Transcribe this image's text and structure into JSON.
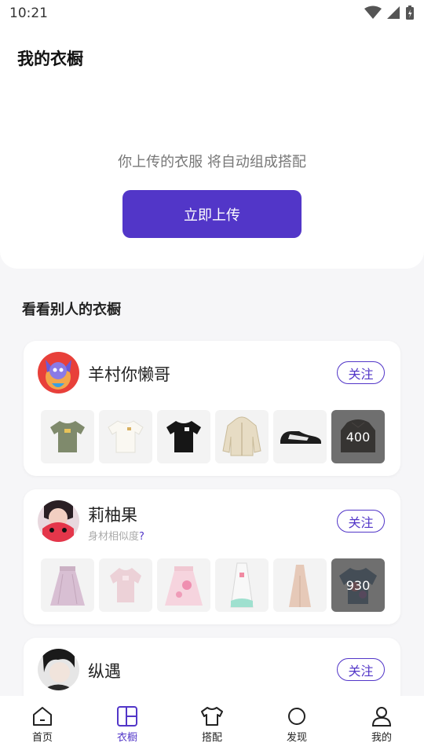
{
  "status_bar": {
    "time": "10:21"
  },
  "header": {
    "title": "我的衣橱"
  },
  "empty_state": {
    "hint": "你上传的衣服 将自动组成搭配",
    "upload_label": "立即上传"
  },
  "section": {
    "title": "看看别人的衣橱"
  },
  "users": [
    {
      "name": "羊村你懒哥",
      "follow_label": "关注",
      "clothes": [
        "olive-tshirt",
        "white-tshirt",
        "black-tshirt",
        "beige-hoodie-jacket",
        "black-white-sneaker"
      ],
      "more_count": "400"
    },
    {
      "name": "莉柚果",
      "similarity_label": "身材相似度",
      "similarity_value": "?",
      "follow_label": "关注",
      "clothes": [
        "pink-skirt",
        "pink-blouse",
        "pink-tulle-skirt",
        "white-dress",
        "beige-dress"
      ],
      "more_count": "930"
    },
    {
      "name": "纵遇",
      "follow_label": "关注"
    }
  ],
  "tab_bar": {
    "tabs": [
      {
        "label": "首页",
        "icon": "home-icon",
        "active": false
      },
      {
        "label": "衣橱",
        "icon": "wardrobe-icon",
        "active": true
      },
      {
        "label": "搭配",
        "icon": "tshirt-icon",
        "active": false
      },
      {
        "label": "发现",
        "icon": "circle-icon",
        "active": false
      },
      {
        "label": "我的",
        "icon": "person-icon",
        "active": false
      }
    ]
  },
  "colors": {
    "accent": "#5236c8",
    "background": "#f6f6f8"
  }
}
